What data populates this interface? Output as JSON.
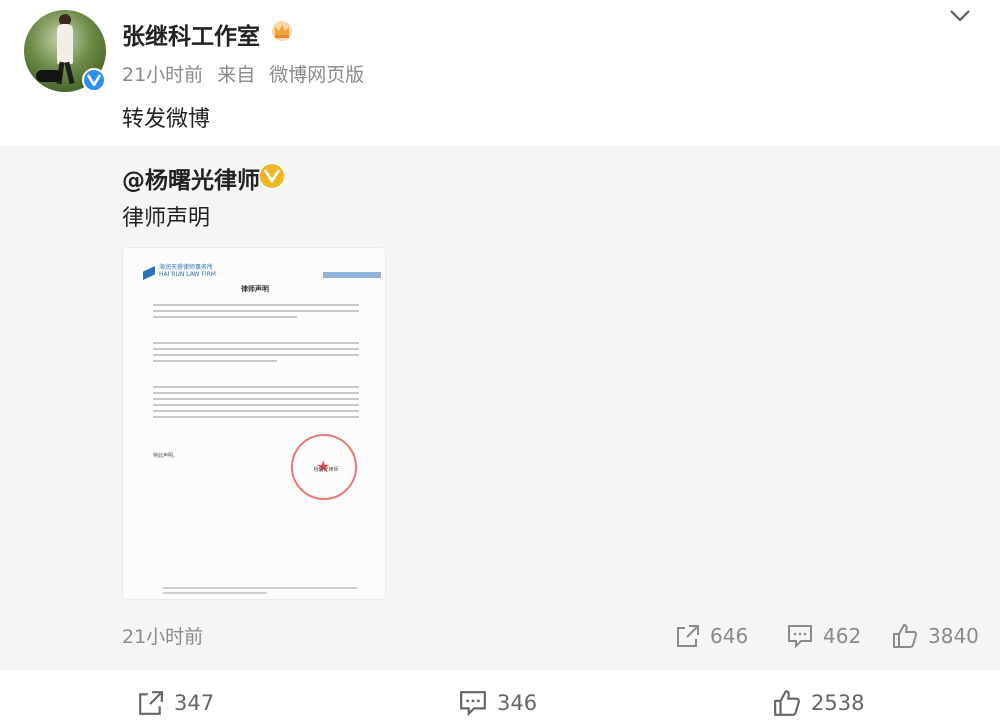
{
  "post": {
    "author": "张继科工作室",
    "time": "21小时前",
    "source_prefix": "来自",
    "source": "微博网页版",
    "text": "转发微博"
  },
  "repost": {
    "author": "@杨曙光律师",
    "text": "律师声明",
    "document": {
      "firm": "海润天睿律师事务所",
      "firm_en": "HAI RUN LAW FIRM",
      "title": "律师声明",
      "closing": "特此声明。",
      "signature": "杨曙光律师"
    },
    "time": "21小时前",
    "stats": {
      "reposts": "646",
      "comments": "462",
      "likes": "3840"
    }
  },
  "stats": {
    "reposts": "347",
    "comments": "346",
    "likes": "2538"
  },
  "colors": {
    "verified_blue": "#2d8ff0",
    "verified_gold": "#f3b424",
    "repost_bg": "#f5f5f5"
  }
}
